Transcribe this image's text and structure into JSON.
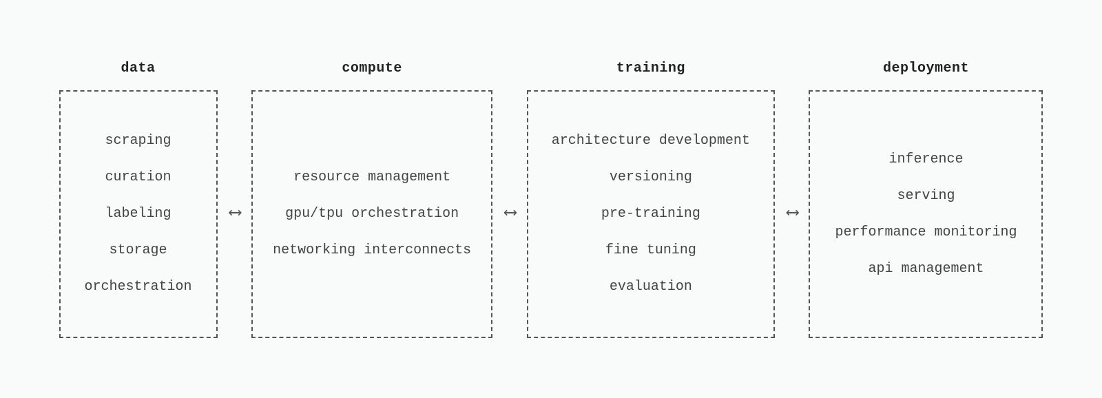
{
  "columns": [
    {
      "title": "data",
      "items": [
        "scraping",
        "curation",
        "labeling",
        "storage",
        "orchestration"
      ]
    },
    {
      "title": "compute",
      "items": [
        "resource management",
        "gpu/tpu orchestration",
        "networking interconnects"
      ]
    },
    {
      "title": "training",
      "items": [
        "architecture development",
        "versioning",
        "pre-training",
        "fine tuning",
        "evaluation"
      ]
    },
    {
      "title": "deployment",
      "items": [
        "inference",
        "serving",
        "performance monitoring",
        "api management"
      ]
    }
  ],
  "connector": "⟷"
}
